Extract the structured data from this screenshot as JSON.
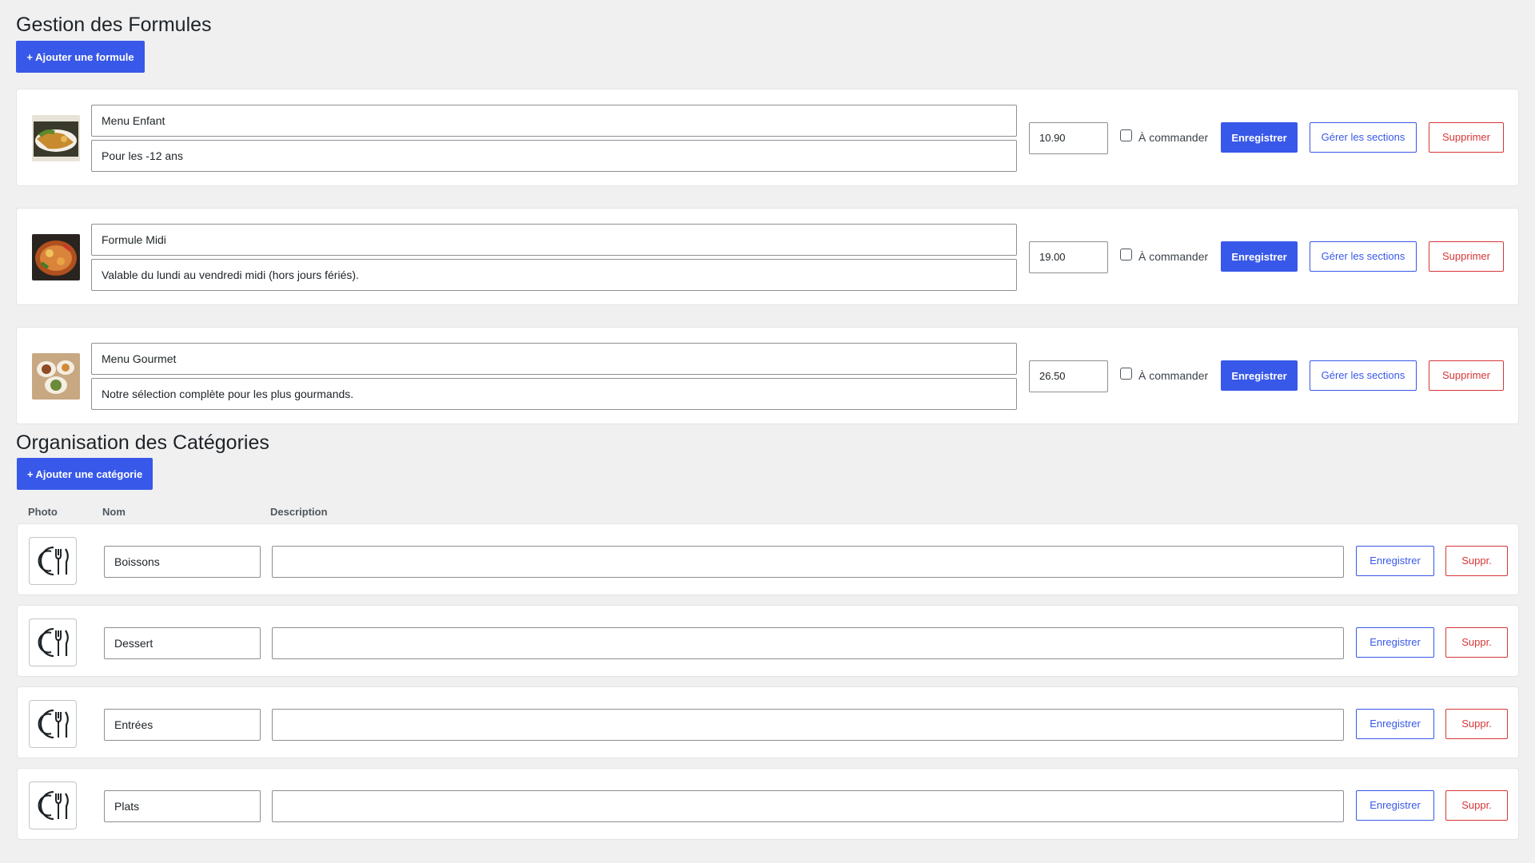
{
  "formulas_section": {
    "title": "Gestion des Formules",
    "add_button": "+ Ajouter une formule",
    "checkbox_label": "À commander",
    "save_label": "Enregistrer",
    "sections_label": "Gérer les sections",
    "delete_label": "Supprimer",
    "items": [
      {
        "name": "Menu Enfant",
        "description": "Pour les -12 ans",
        "price": "10.90",
        "to_order": false,
        "image": "food-photo-icon"
      },
      {
        "name": "Formule Midi",
        "description": "Valable du lundi au vendredi midi (hors jours fériés).",
        "price": "19.00",
        "to_order": false,
        "image": "food-photo-icon"
      },
      {
        "name": "Menu Gourmet",
        "description": "Notre sélection complète pour les plus gourmands.",
        "price": "26.50",
        "to_order": false,
        "image": "food-photo-icon"
      }
    ]
  },
  "categories_section": {
    "title": "Organisation des Catégories",
    "add_button": "+ Ajouter une catégorie",
    "columns": {
      "photo": "Photo",
      "name": "Nom",
      "description": "Description"
    },
    "save_label": "Enregistrer",
    "delete_label": "Suppr.",
    "items": [
      {
        "name": "Boissons",
        "description": "",
        "icon": "cutlery-icon"
      },
      {
        "name": "Dessert",
        "description": "",
        "icon": "cutlery-icon"
      },
      {
        "name": "Entrées",
        "description": "",
        "icon": "cutlery-icon"
      },
      {
        "name": "Plats",
        "description": "",
        "icon": "cutlery-icon"
      }
    ]
  },
  "colors": {
    "primary": "#3858e9",
    "danger": "#d63638",
    "background": "#f0f0f1"
  }
}
